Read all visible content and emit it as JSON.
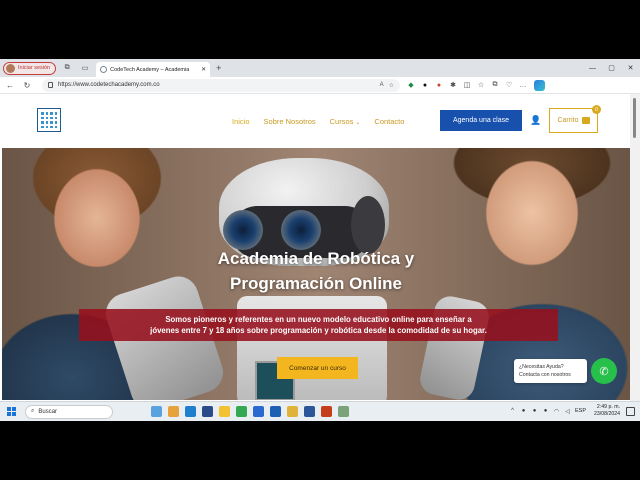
{
  "browser": {
    "profile_label": "Iniciar sesión",
    "tab_title": "CodeTech Academy – Academia",
    "url": "https://www.codetechacademy.com.co",
    "win_min": "—",
    "win_max": "▢",
    "win_close": "✕"
  },
  "site": {
    "menu": {
      "home": "Inicio",
      "about": "Sobre Nosotros",
      "courses": "Cursos",
      "contact": "Contacto"
    },
    "cta_label": "Agenda una clase",
    "cart_label": "Carrito",
    "cart_count": "0"
  },
  "hero": {
    "title_line1": "Academia de Robótica y",
    "title_line2": "Programación Online",
    "desc_line1": "Somos pioneros y referentes en un nuevo modelo educativo online para enseñar a",
    "desc_line2": "jóvenes entre 7 y 18 años sobre programación y robótica desde la comodidad de su hogar.",
    "button_label": "Comenzar un curso"
  },
  "whatsapp": {
    "line1": "¿Necesitas Ayuda?",
    "line2": "Contacta con nosotros"
  },
  "taskbar": {
    "search_placeholder": "Buscar",
    "lang": "ESP",
    "time": "2:49 p. m.",
    "date": "23/08/2024"
  },
  "colors": {
    "accent_gold": "#d8a91e",
    "cta_blue": "#1851ad",
    "band_red": "#96101c",
    "whatsapp_green": "#27c04a"
  }
}
